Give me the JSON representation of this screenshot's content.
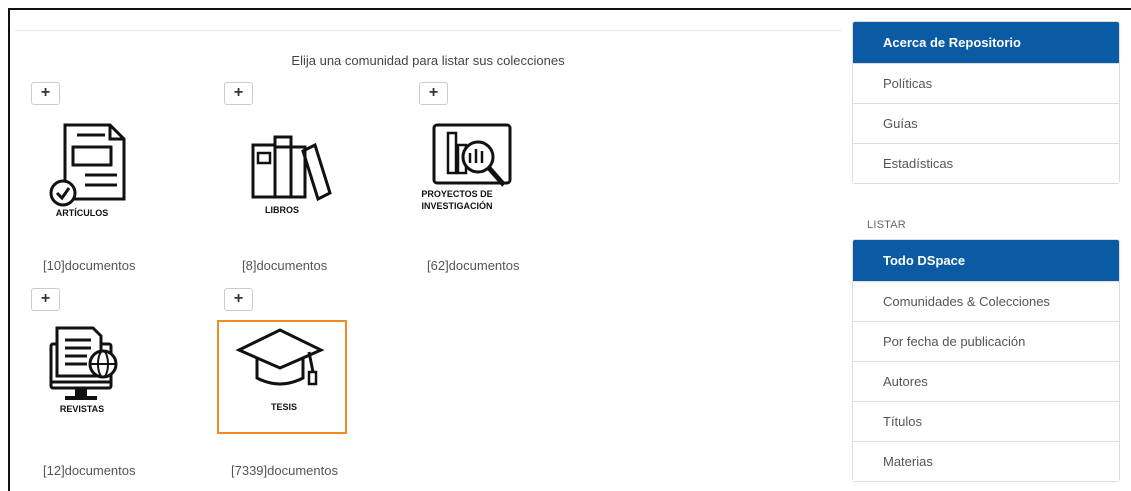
{
  "main": {
    "intro": "Elija una comunidad para listar sus colecciones",
    "communities": [
      {
        "label_lines": [
          "ARTÍCULOS"
        ],
        "count": "[10]documentos",
        "icon": "document-check-icon"
      },
      {
        "label_lines": [
          "LIBROS"
        ],
        "count": "[8]documentos",
        "icon": "books-icon"
      },
      {
        "label_lines": [
          "PROYECTOS DE",
          "INVESTIGACIÓN"
        ],
        "count": "[62]documentos",
        "icon": "chart-magnifier-icon"
      },
      {
        "label_lines": [
          "REVISTAS"
        ],
        "count": "[12]documentos",
        "icon": "computer-globe-icon"
      },
      {
        "label_lines": [
          "TESIS"
        ],
        "count": "[7339]documentos",
        "icon": "graduation-cap-icon",
        "selected": true
      }
    ],
    "expand_symbol": "+"
  },
  "sidebar": {
    "about_items": [
      "Acerca de Repositorio",
      "Políticas",
      "Guías",
      "Estadísticas"
    ],
    "browse_heading": "LISTAR",
    "browse_items": [
      "Todo DSpace",
      "Comunidades & Colecciones",
      "Por fecha de publicación",
      "Autores",
      "Títulos",
      "Materias"
    ]
  },
  "colors": {
    "accent": "#0b5aa4",
    "selected_border": "#f08a24"
  }
}
